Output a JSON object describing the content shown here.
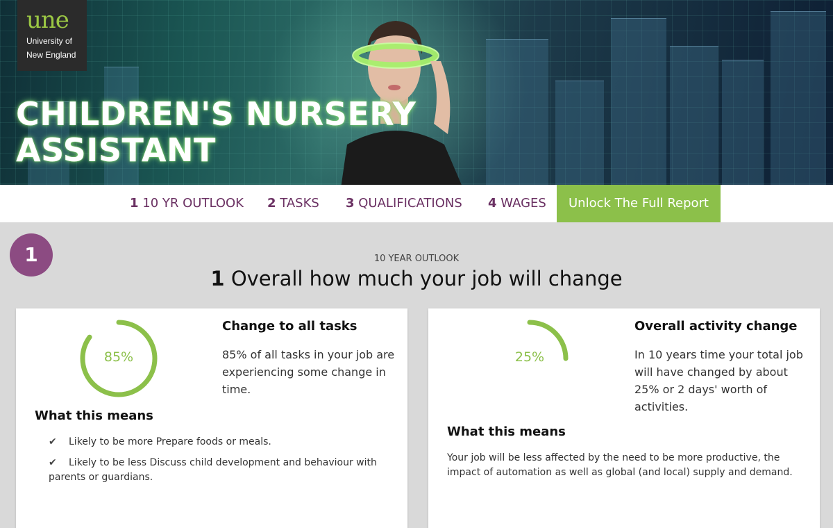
{
  "brand": {
    "logo_mark": "une",
    "logo_line1": "University of",
    "logo_line2": "New England"
  },
  "hero": {
    "title_line1": "CHILDREN'S NURSERY",
    "title_line2": "ASSISTANT"
  },
  "nav": {
    "items": [
      {
        "num": "1",
        "label": "10 YR OUTLOOK"
      },
      {
        "num": "2",
        "label": "TASKS"
      },
      {
        "num": "3",
        "label": "QUALIFICATIONS"
      },
      {
        "num": "4",
        "label": "WAGES"
      }
    ],
    "cta_label": "Unlock The Full Report"
  },
  "section": {
    "step": "1",
    "eyebrow": "10 YEAR OUTLOOK",
    "title_num": "1",
    "title_text": "Overall how much your job will change"
  },
  "cards": [
    {
      "ring_value": 0.85,
      "ring_label": "85%",
      "heading": "Change to all tasks",
      "text": "85% of all tasks in your job are experiencing some change in time.",
      "means_heading": "What this means",
      "bullets": [
        "Likely to be more Prepare foods or meals.",
        "Likely to be less Discuss child development and behaviour with parents or guardians."
      ]
    },
    {
      "ring_value": 0.25,
      "ring_label": "25%",
      "heading": "Overall activity change",
      "text": "In 10 years time your total job will have changed by about 25% or 2 days' worth of activities.",
      "means_heading": "What this means",
      "means_text": "Your job will be less affected by the need to be more productive, the impact of automation as well as global (and local) supply and demand."
    }
  ],
  "colors": {
    "accent_green": "#8cc04a",
    "brand_purple": "#6b3163",
    "badge_purple": "#8c4b82",
    "background_grey": "#d9d9d9"
  },
  "icons": {
    "check": "check-icon"
  }
}
